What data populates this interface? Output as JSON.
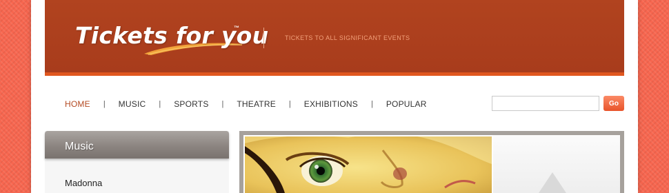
{
  "header": {
    "logo_text": "Tickets for you",
    "logo_tm": "™",
    "tagline": "TICKETS TO ALL SIGNIFICANT EVENTS"
  },
  "nav": {
    "items": [
      {
        "label": "HOME",
        "active": true
      },
      {
        "label": "MUSIC"
      },
      {
        "label": "SPORTS"
      },
      {
        "label": "THEATRE"
      },
      {
        "label": "EXHIBITIONS"
      },
      {
        "label": "POPULAR"
      }
    ],
    "separator": "|"
  },
  "search": {
    "value": "",
    "button_label": "Go"
  },
  "sidebar": {
    "title": "Music",
    "items": [
      {
        "label": "Madonna"
      }
    ]
  },
  "colors": {
    "background": "#f7664f",
    "header": "#a83c1c",
    "header_stripe": "#e0571f",
    "active_nav": "#b44a22",
    "go_button": "#e8532a"
  },
  "icons": {
    "logo_swoosh": "orange-swoosh",
    "banner_arrow": "up-triangle"
  }
}
